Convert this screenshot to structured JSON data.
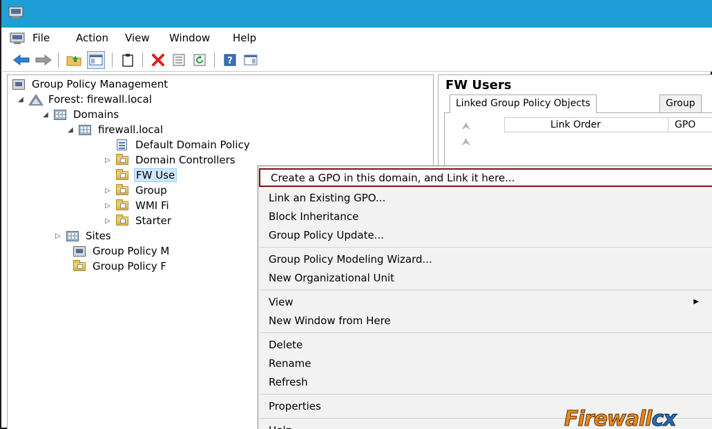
{
  "menubar": {
    "items": [
      "File",
      "Action",
      "View",
      "Window",
      "Help"
    ]
  },
  "toolbar": {
    "buttons": [
      "back-arrow-icon",
      "forward-arrow-icon",
      "up-folder-icon",
      "show-hide-console-tree-icon",
      "clipboard-icon",
      "delete-icon",
      "properties-icon",
      "refresh-icon",
      "help-icon",
      "action-pane-icon"
    ]
  },
  "tree": {
    "root": "Group Policy Management",
    "forest": "Forest: firewall.local",
    "domains": "Domains",
    "domain": "firewall.local",
    "default_domain_policy": "Default Domain Policy",
    "domain_controllers": "Domain Controllers",
    "fw_users": "FW Use",
    "group": "Group",
    "wmi": "WMI Fi",
    "starter": "Starter",
    "sites": "Sites",
    "gp_modeling": "Group Policy M",
    "gp_results": "Group Policy F"
  },
  "details": {
    "title": "FW Users",
    "tabs": [
      "Linked Group Policy Objects",
      "Group"
    ],
    "columns": [
      "Link Order",
      "GPO"
    ]
  },
  "context_menu": {
    "items": [
      "Create a GPO in this domain, and Link it here...",
      "Link an Existing GPO...",
      "Block Inheritance",
      "Group Policy Update...",
      "Group Policy Modeling Wizard...",
      "New Organizational Unit",
      "View",
      "New Window from Here",
      "Delete",
      "Rename",
      "Refresh",
      "Properties",
      "Help"
    ],
    "highlighted_index": 0
  },
  "watermark": {
    "part1": "Firewall",
    "part2": "cx"
  },
  "colors": {
    "titlebar": "#1e9fd8",
    "highlight_border": "#7b1414",
    "selection": "#cce8ff"
  }
}
